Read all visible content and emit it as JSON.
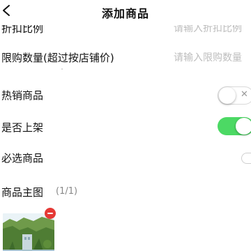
{
  "header": {
    "title": "添加商品",
    "back_icon": "chevron-left-icon"
  },
  "form": {
    "discount": {
      "label": "折扣比例",
      "placeholder": "请输入折扣比例"
    },
    "purchase_limit": {
      "label": "限购数量(超过按店铺价)",
      "placeholder": "请输入限购数量"
    },
    "hot_sale": {
      "label": "热销商品",
      "enabled": false,
      "off_mark": "✕"
    },
    "on_shelf": {
      "label": "是否上架",
      "enabled": true
    },
    "required": {
      "label": "必选商品",
      "enabled": false
    }
  },
  "images": {
    "title": "商品主图",
    "count": "(1/1)"
  },
  "colors": {
    "switch_on": "#4cd964",
    "switch_off_border": "#d9d9d9",
    "remove_badge": "#e53935",
    "placeholder": "#bdbdbd"
  }
}
